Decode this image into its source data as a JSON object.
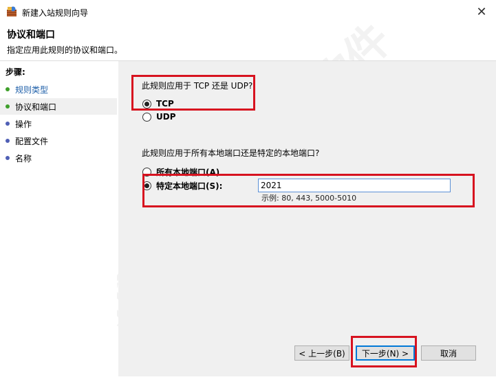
{
  "window": {
    "title": "新建入站规则向导",
    "close_label": "✕"
  },
  "header": {
    "title": "协议和端口",
    "subtitle": "指定应用此规则的协议和端口。"
  },
  "sidebar": {
    "steps_label": "步骤:",
    "items": [
      {
        "label": "规则类型",
        "color": "#3e9f2a"
      },
      {
        "label": "协议和端口",
        "color": "#3e9f2a"
      },
      {
        "label": "操作",
        "color": "#4f5fb5"
      },
      {
        "label": "配置文件",
        "color": "#4f5fb5"
      },
      {
        "label": "名称",
        "color": "#4f5fb5"
      }
    ]
  },
  "protocol": {
    "question": "此规则应用于 TCP 还是 UDP?",
    "options": [
      "TCP",
      "UDP"
    ],
    "selected": "TCP"
  },
  "ports": {
    "question": "此规则应用于所有本地端口还是特定的本地端口?",
    "all_label": "所有本地端口(A)",
    "specific_label": "特定本地端口(S):",
    "selected": "specific",
    "value": "2021",
    "example": "示例: 80, 443, 5000-5010"
  },
  "buttons": {
    "back": "< 上一步(B)",
    "next": "下一步(N) >",
    "cancel": "取消"
  },
  "highlight_color": "#d7121f",
  "watermark": "营前阁软件"
}
